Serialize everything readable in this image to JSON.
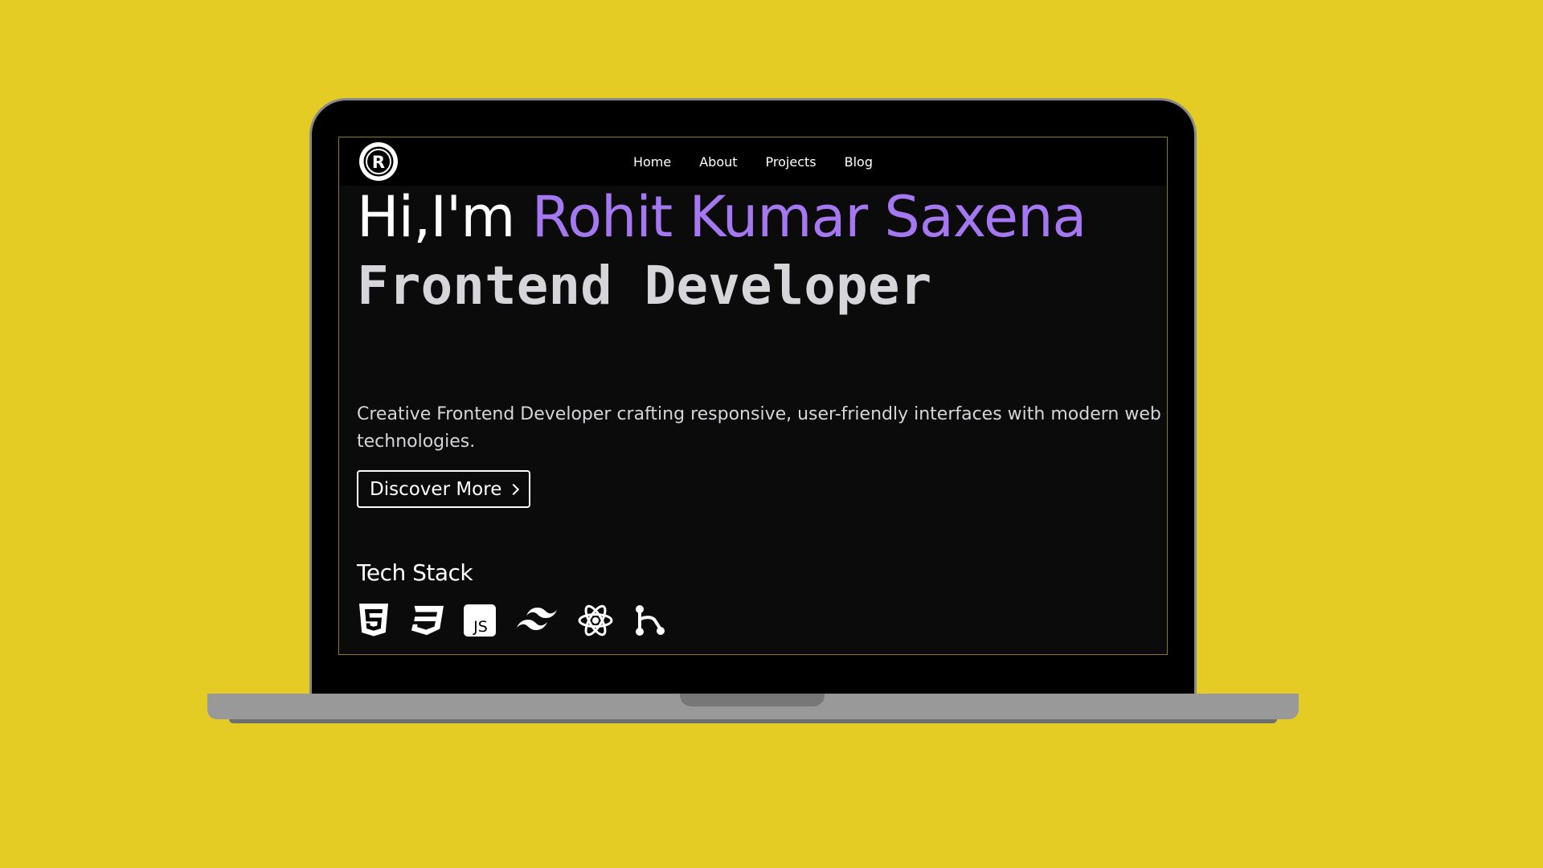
{
  "nav": {
    "logo_letter": "R",
    "items": [
      {
        "label": "Home"
      },
      {
        "label": "About"
      },
      {
        "label": "Projects"
      },
      {
        "label": "Blog"
      }
    ]
  },
  "hero": {
    "greeting": "Hi,I'm ",
    "name": "Rohit Kumar Saxena",
    "role": "Frontend Developer",
    "description": "Creative Frontend Developer crafting responsive, user-friendly interfaces with modern web technologies.",
    "cta_label": "Discover More"
  },
  "tech_stack": {
    "title": "Tech Stack",
    "icons": [
      "html5-icon",
      "css3-icon",
      "javascript-icon",
      "tailwind-icon",
      "react-icon",
      "git-icon"
    ],
    "js_text": "JS"
  },
  "colors": {
    "background": "#E5CC24",
    "accent": "#a578f2",
    "screen_bg": "#0b0b0b"
  }
}
